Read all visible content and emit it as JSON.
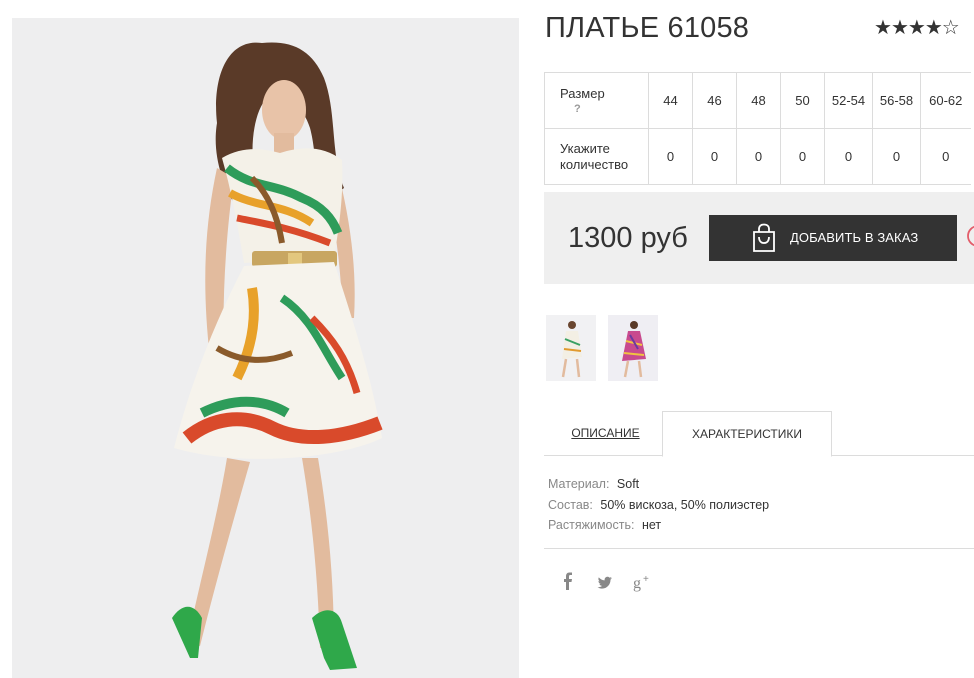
{
  "product": {
    "title": "ПЛАТЬЕ 61058",
    "rating": 4,
    "rating_max": 5
  },
  "sizes": {
    "row_size_label": "Размер",
    "help_mark": "?",
    "row_qty_label": "Укажите количество",
    "list": [
      "44",
      "46",
      "48",
      "50",
      "52-54",
      "56-58",
      "60-62"
    ],
    "quantities": [
      "0",
      "0",
      "0",
      "0",
      "0",
      "0",
      "0"
    ]
  },
  "buy": {
    "price": "1300 руб",
    "add_label": "ДОБАВИТЬ В ЗАКАЗ",
    "button_color": "#333333",
    "wishlist_color": "#e35d6a"
  },
  "tabs": {
    "description": "ОПИСАНИЕ",
    "characteristics": "ХАРАКТЕРИСТИКИ",
    "active": "characteristics"
  },
  "specs": [
    {
      "key": "Материал:",
      "value": "Soft"
    },
    {
      "key": "Состав:",
      "value": "50% вискоза, 50% полиэстер"
    },
    {
      "key": "Растяжимость:",
      "value": "нет"
    }
  ],
  "social": {
    "facebook": "f",
    "twitter": "twitter-icon",
    "google_plus": "g+"
  }
}
